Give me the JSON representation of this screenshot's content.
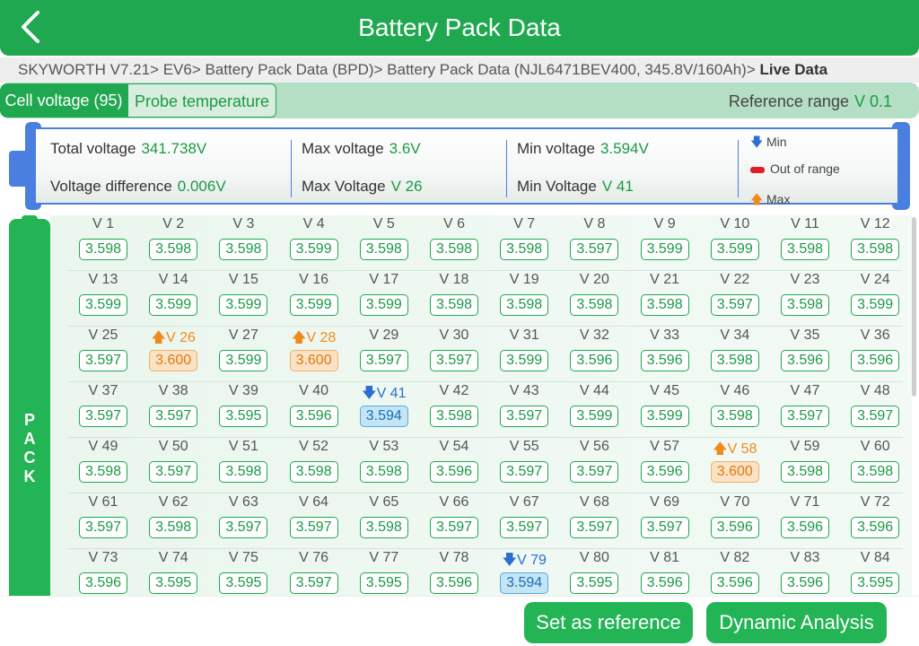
{
  "header": {
    "title": "Battery Pack Data"
  },
  "breadcrumb": {
    "path": "SKYWORTH V7.21> EV6> Battery Pack Data (BPD)> Battery Pack Data (NJL6471BEV400, 345.8V/160Ah)> ",
    "current": "Live Data"
  },
  "tabs": [
    {
      "label": "Cell voltage (95)",
      "active": true
    },
    {
      "label": "Probe temperature",
      "active": false
    }
  ],
  "reference_range": {
    "label": "Reference range",
    "value": "V 0.1"
  },
  "summary": {
    "total_voltage": {
      "label": "Total voltage",
      "value": "341.738V"
    },
    "voltage_difference": {
      "label": "Voltage difference",
      "value": "0.006V"
    },
    "max_voltage": {
      "label": "Max voltage",
      "value": "3.6V"
    },
    "max_voltage_cell": {
      "label": "Max Voltage",
      "value": "V 26"
    },
    "min_voltage": {
      "label": "Min voltage",
      "value": "3.594V"
    },
    "min_voltage_cell": {
      "label": "Min Voltage",
      "value": "V 41"
    }
  },
  "legend": {
    "min": "Min",
    "out_of_range": "Out of range",
    "max": "Max"
  },
  "pack_label": "PACK",
  "icons": {
    "back": "chevron-left-icon",
    "min": "arrow-down-icon",
    "max": "arrow-up-icon",
    "out_of_range": "red-pill-icon"
  },
  "colors": {
    "primary": "#1fa84f",
    "max": "#f08a1c",
    "min": "#2b6fd0",
    "out_of_range": "#e02020",
    "summary_frame": "#4a7fe0"
  },
  "cells": [
    {
      "label": "V 1",
      "value": "3.598"
    },
    {
      "label": "V 2",
      "value": "3.598"
    },
    {
      "label": "V 3",
      "value": "3.598"
    },
    {
      "label": "V 4",
      "value": "3.599"
    },
    {
      "label": "V 5",
      "value": "3.598"
    },
    {
      "label": "V 6",
      "value": "3.598"
    },
    {
      "label": "V 7",
      "value": "3.598"
    },
    {
      "label": "V 8",
      "value": "3.597"
    },
    {
      "label": "V 9",
      "value": "3.599"
    },
    {
      "label": "V 10",
      "value": "3.599"
    },
    {
      "label": "V 11",
      "value": "3.598"
    },
    {
      "label": "V 12",
      "value": "3.598"
    },
    {
      "label": "V 13",
      "value": "3.599"
    },
    {
      "label": "V 14",
      "value": "3.599"
    },
    {
      "label": "V 15",
      "value": "3.599"
    },
    {
      "label": "V 16",
      "value": "3.599"
    },
    {
      "label": "V 17",
      "value": "3.599"
    },
    {
      "label": "V 18",
      "value": "3.598"
    },
    {
      "label": "V 19",
      "value": "3.598"
    },
    {
      "label": "V 20",
      "value": "3.598"
    },
    {
      "label": "V 21",
      "value": "3.598"
    },
    {
      "label": "V 22",
      "value": "3.597"
    },
    {
      "label": "V 23",
      "value": "3.598"
    },
    {
      "label": "V 24",
      "value": "3.599"
    },
    {
      "label": "V 25",
      "value": "3.597"
    },
    {
      "label": "V 26",
      "value": "3.600",
      "status": "max"
    },
    {
      "label": "V 27",
      "value": "3.599"
    },
    {
      "label": "V 28",
      "value": "3.600",
      "status": "max"
    },
    {
      "label": "V 29",
      "value": "3.597"
    },
    {
      "label": "V 30",
      "value": "3.597"
    },
    {
      "label": "V 31",
      "value": "3.599"
    },
    {
      "label": "V 32",
      "value": "3.596"
    },
    {
      "label": "V 33",
      "value": "3.596"
    },
    {
      "label": "V 34",
      "value": "3.598"
    },
    {
      "label": "V 35",
      "value": "3.596"
    },
    {
      "label": "V 36",
      "value": "3.596"
    },
    {
      "label": "V 37",
      "value": "3.597"
    },
    {
      "label": "V 38",
      "value": "3.597"
    },
    {
      "label": "V 39",
      "value": "3.595"
    },
    {
      "label": "V 40",
      "value": "3.596"
    },
    {
      "label": "V 41",
      "value": "3.594",
      "status": "min"
    },
    {
      "label": "V 42",
      "value": "3.598"
    },
    {
      "label": "V 43",
      "value": "3.597"
    },
    {
      "label": "V 44",
      "value": "3.599"
    },
    {
      "label": "V 45",
      "value": "3.599"
    },
    {
      "label": "V 46",
      "value": "3.598"
    },
    {
      "label": "V 47",
      "value": "3.597"
    },
    {
      "label": "V 48",
      "value": "3.597"
    },
    {
      "label": "V 49",
      "value": "3.598"
    },
    {
      "label": "V 50",
      "value": "3.597"
    },
    {
      "label": "V 51",
      "value": "3.598"
    },
    {
      "label": "V 52",
      "value": "3.598"
    },
    {
      "label": "V 53",
      "value": "3.598"
    },
    {
      "label": "V 54",
      "value": "3.596"
    },
    {
      "label": "V 55",
      "value": "3.597"
    },
    {
      "label": "V 56",
      "value": "3.597"
    },
    {
      "label": "V 57",
      "value": "3.596"
    },
    {
      "label": "V 58",
      "value": "3.600",
      "status": "max"
    },
    {
      "label": "V 59",
      "value": "3.598"
    },
    {
      "label": "V 60",
      "value": "3.598"
    },
    {
      "label": "V 61",
      "value": "3.597"
    },
    {
      "label": "V 62",
      "value": "3.598"
    },
    {
      "label": "V 63",
      "value": "3.597"
    },
    {
      "label": "V 64",
      "value": "3.597"
    },
    {
      "label": "V 65",
      "value": "3.598"
    },
    {
      "label": "V 66",
      "value": "3.597"
    },
    {
      "label": "V 67",
      "value": "3.597"
    },
    {
      "label": "V 68",
      "value": "3.597"
    },
    {
      "label": "V 69",
      "value": "3.597"
    },
    {
      "label": "V 70",
      "value": "3.596"
    },
    {
      "label": "V 71",
      "value": "3.596"
    },
    {
      "label": "V 72",
      "value": "3.596"
    },
    {
      "label": "V 73",
      "value": "3.596"
    },
    {
      "label": "V 74",
      "value": "3.595"
    },
    {
      "label": "V 75",
      "value": "3.595"
    },
    {
      "label": "V 76",
      "value": "3.597"
    },
    {
      "label": "V 77",
      "value": "3.595"
    },
    {
      "label": "V 78",
      "value": "3.596"
    },
    {
      "label": "V 79",
      "value": "3.594",
      "status": "min"
    },
    {
      "label": "V 80",
      "value": "3.595"
    },
    {
      "label": "V 81",
      "value": "3.596"
    },
    {
      "label": "V 82",
      "value": "3.596"
    },
    {
      "label": "V 83",
      "value": "3.596"
    },
    {
      "label": "V 84",
      "value": "3.595"
    }
  ],
  "buttons": {
    "set_reference": "Set as reference",
    "dynamic_analysis": "Dynamic Analysis"
  }
}
